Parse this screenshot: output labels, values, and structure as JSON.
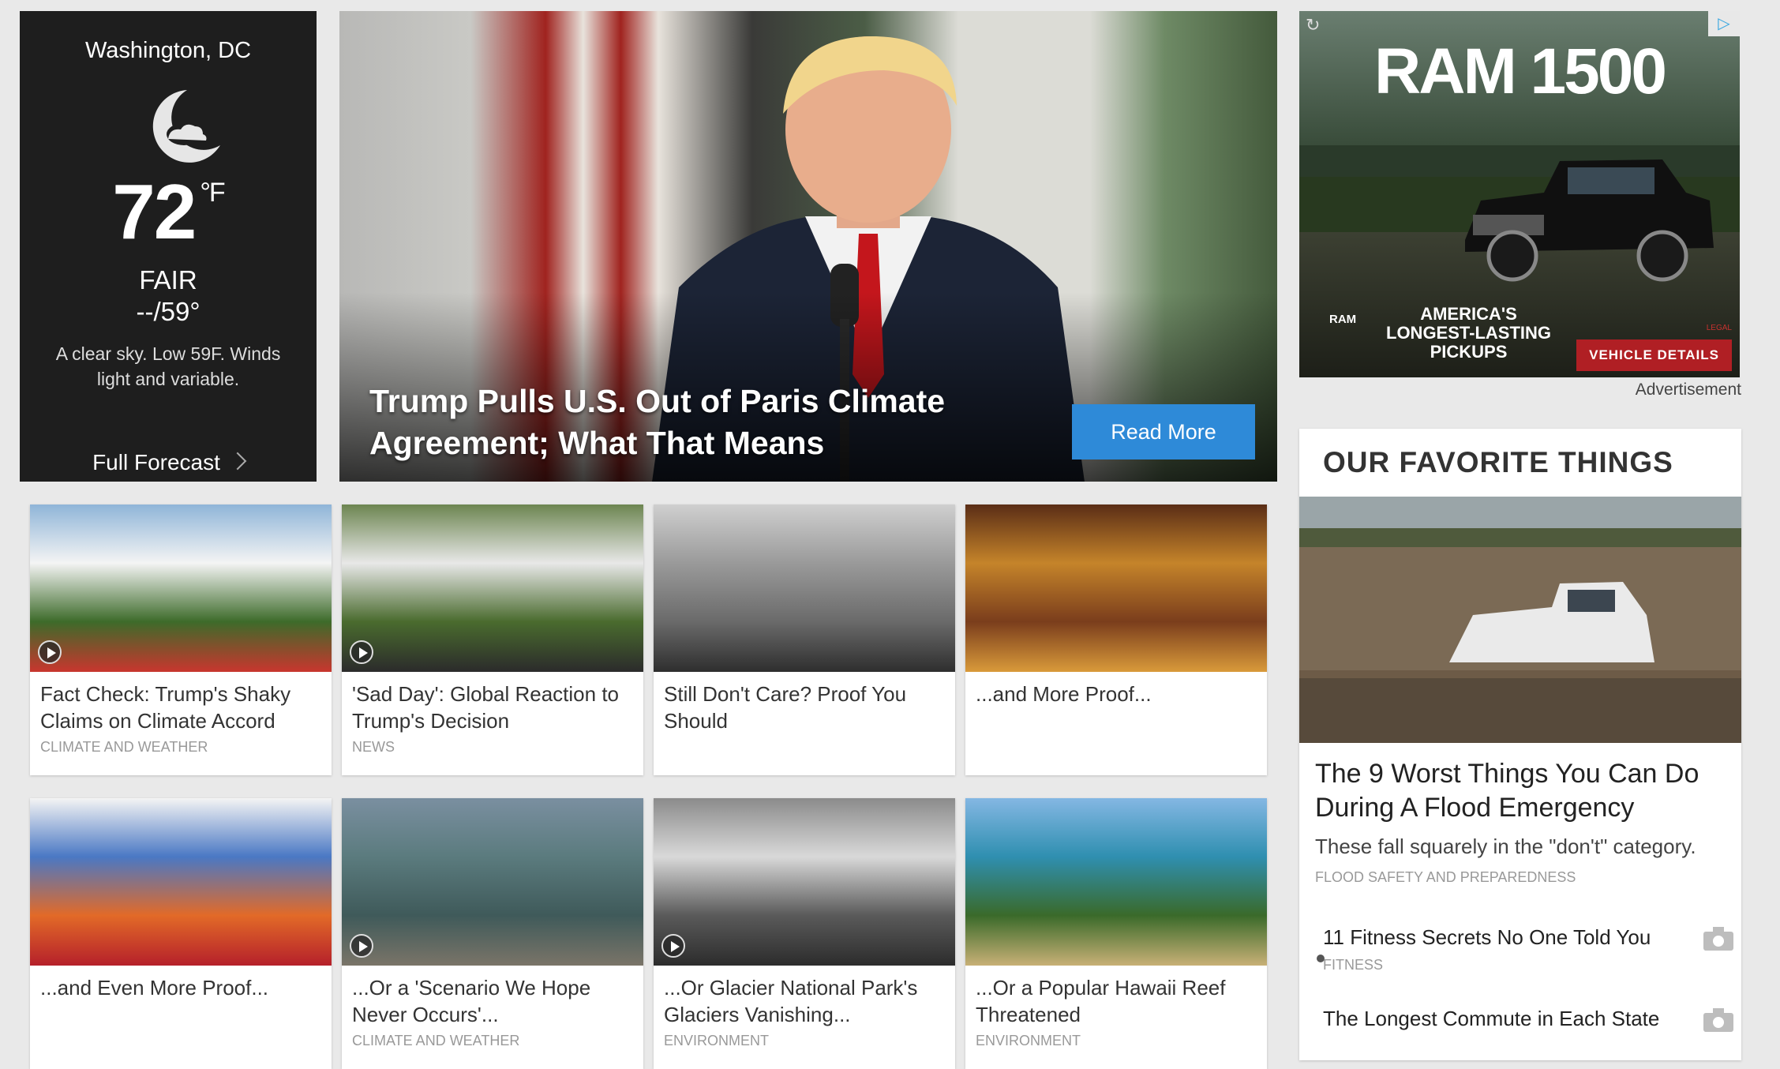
{
  "weather": {
    "location": "Washington, DC",
    "icon": "moon-cloud-icon",
    "temp": "72",
    "unit": "°F",
    "condition": "FAIR",
    "hilo": "--/59°",
    "description": "A clear sky. Low 59F. Winds light and variable.",
    "forecast_link": "Full Forecast"
  },
  "hero": {
    "headline": "Trump Pulls U.S. Out of Paris Climate Agreement; What That Means",
    "button": "Read More"
  },
  "ad": {
    "title": "RAM 1500",
    "tagline_1": "AMERICA'S",
    "tagline_2": "LONGEST-LASTING",
    "tagline_3": "PICKUPS",
    "brand": "RAM",
    "legal": "LEGAL",
    "cta": "VEHICLE DETAILS",
    "label": "Advertisement"
  },
  "cards": [
    {
      "title": "Fact Check: Trump's Shaky Claims on Climate Accord",
      "tag": "Climate and Weather",
      "video": true
    },
    {
      "title": "'Sad Day': Global Reaction to Trump's Decision",
      "tag": "News",
      "video": true
    },
    {
      "title": "Still Don't Care? Proof You Should",
      "tag": "",
      "video": false
    },
    {
      "title": "...and More Proof...",
      "tag": "",
      "video": false
    },
    {
      "title": "...and Even More Proof...",
      "tag": "",
      "video": false
    },
    {
      "title": "...Or a 'Scenario We Hope Never Occurs'...",
      "tag": "Climate and Weather",
      "video": true
    },
    {
      "title": "...Or Glacier National Park's Glaciers Vanishing...",
      "tag": "Environment",
      "video": true
    },
    {
      "title": "...Or a Popular Hawaii Reef Threatened",
      "tag": "Environment",
      "video": false
    }
  ],
  "favorites": {
    "heading": "OUR FAVORITE THINGS",
    "featured_title": "The 9 Worst Things You Can Do During A Flood Emergency",
    "featured_desc": "These fall squarely in the \"don't\" category.",
    "featured_tag": "FLOOD SAFETY AND PREPAREDNESS",
    "items": [
      {
        "title": "11 Fitness Secrets No One Told You",
        "tag": "FITNESS"
      },
      {
        "title": "The Longest Commute in Each State",
        "tag": ""
      }
    ]
  },
  "colors": {
    "accent": "#2e8ad8",
    "ad_red": "#b01f24",
    "weather_bg": "#1e1e1e"
  }
}
